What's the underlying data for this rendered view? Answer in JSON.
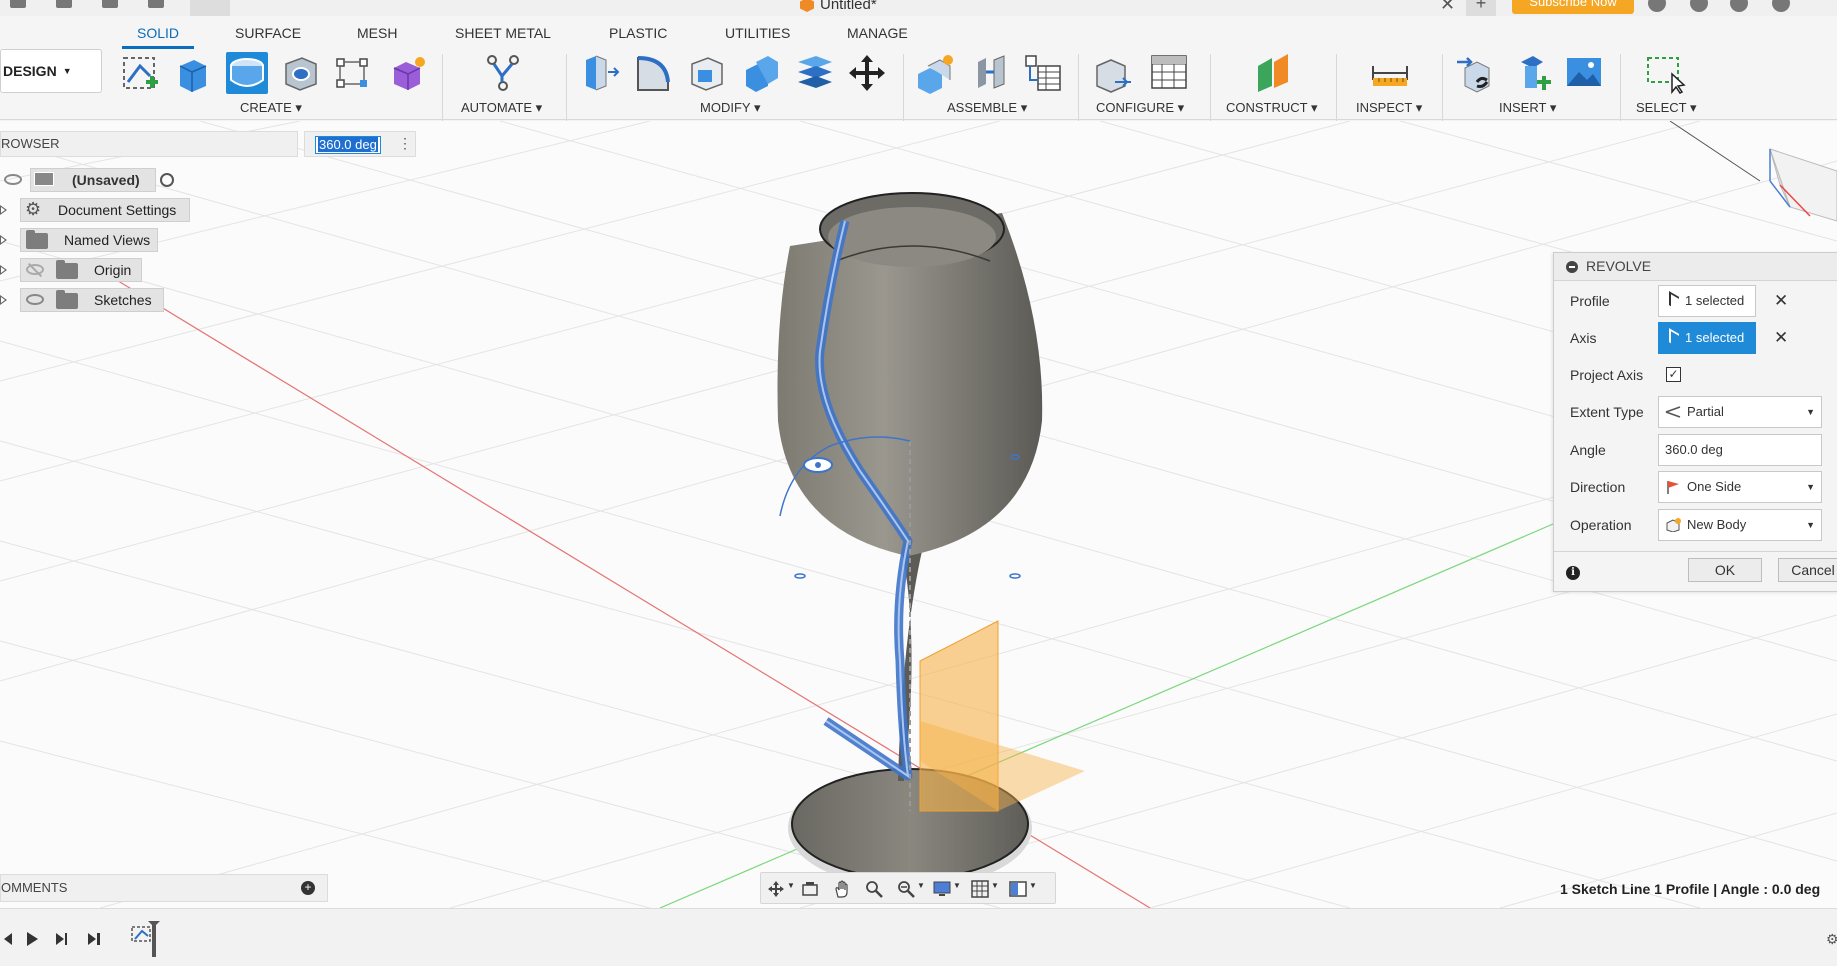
{
  "window": {
    "title": "Untitled*",
    "subscribe_label": "Subscribe Now"
  },
  "workspace": {
    "label": "DESIGN"
  },
  "tabs": [
    {
      "label": "SOLID",
      "active": true
    },
    {
      "label": "SURFACE"
    },
    {
      "label": "MESH"
    },
    {
      "label": "SHEET METAL"
    },
    {
      "label": "PLASTIC"
    },
    {
      "label": "UTILITIES"
    },
    {
      "label": "MANAGE"
    }
  ],
  "groups": {
    "create": "CREATE",
    "automate": "AUTOMATE",
    "modify": "MODIFY",
    "assemble": "ASSEMBLE",
    "configure": "CONFIGURE",
    "construct": "CONSTRUCT",
    "inspect": "INSPECT",
    "insert": "INSERT",
    "select": "SELECT"
  },
  "browser": {
    "title": "ROWSER",
    "angle_input": "360.0 deg",
    "root": "(Unsaved)",
    "items": [
      {
        "label": "Document Settings"
      },
      {
        "label": "Named Views"
      },
      {
        "label": "Origin"
      },
      {
        "label": "Sketches"
      }
    ]
  },
  "comments": {
    "title": "OMMENTS"
  },
  "status_text": "1 Sketch Line 1 Profile | Angle : 0.0 deg",
  "revolve": {
    "title": "REVOLVE",
    "profile": {
      "label": "Profile",
      "value": "1 selected"
    },
    "axis": {
      "label": "Axis",
      "value": "1 selected"
    },
    "project_axis": {
      "label": "Project Axis",
      "checked": true
    },
    "extent_type": {
      "label": "Extent Type",
      "value": "Partial"
    },
    "angle": {
      "label": "Angle",
      "value": "360.0 deg"
    },
    "direction": {
      "label": "Direction",
      "value": "One Side"
    },
    "operation": {
      "label": "Operation",
      "value": "New Body"
    },
    "ok_label": "OK",
    "cancel_label": "Cancel"
  },
  "colors": {
    "accent": "#1f8ad8",
    "subscribe": "#f5a623",
    "profile_highlight": "#3f74c9",
    "preview_plane": "#f6b24a"
  }
}
